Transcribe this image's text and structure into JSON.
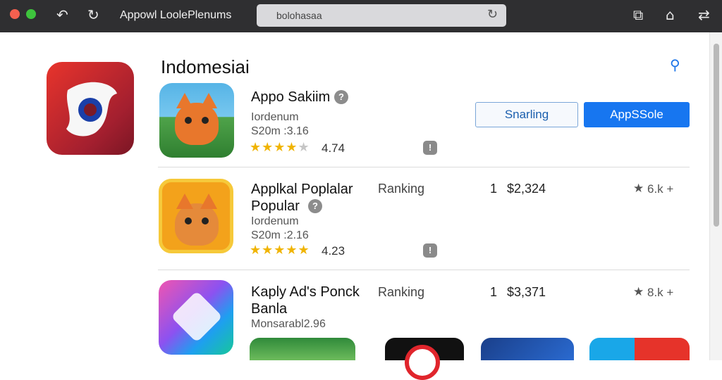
{
  "window": {
    "title": "Appowl LoolePlenums",
    "url": "bolohasaa",
    "icons": {
      "back": "back-arrow-icon",
      "reload": "reload-icon",
      "share": "share-icon",
      "home": "home-icon",
      "menu": "menu-icon"
    }
  },
  "page": {
    "title": "Indomesiai"
  },
  "featured": {
    "name": "Appo Sakiim",
    "subtitle": "Iordenum",
    "size": "S20m :3.16",
    "stars": 4,
    "rating": "4.74",
    "secondary_button": "Snarling",
    "primary_button": "AppSSole"
  },
  "apps": [
    {
      "name": "Applkal Poplalar Popular",
      "name_line1": "Applkal Poplalar",
      "name_line2": "Popular",
      "subtitle": "Iordenum",
      "size": "S20m :2.16",
      "stars": 5,
      "rating": "4.23",
      "ranking_label": "Ranking",
      "rank": "1",
      "price": "$2,324",
      "reviews": "6.k +"
    },
    {
      "name": "Kaply Ad's Ponck Banla",
      "name_line1": "Kaply Ad's Ponck",
      "name_line2": "Banla",
      "subtitle": "Monsarabl2.96",
      "ranking_label": "Ranking",
      "rank": "1",
      "price": "$3,371",
      "reviews": "8.k +"
    }
  ],
  "colors": {
    "primary_button": "#1776f0",
    "star": "#f0b400",
    "titlebar": "#2f2f31"
  }
}
